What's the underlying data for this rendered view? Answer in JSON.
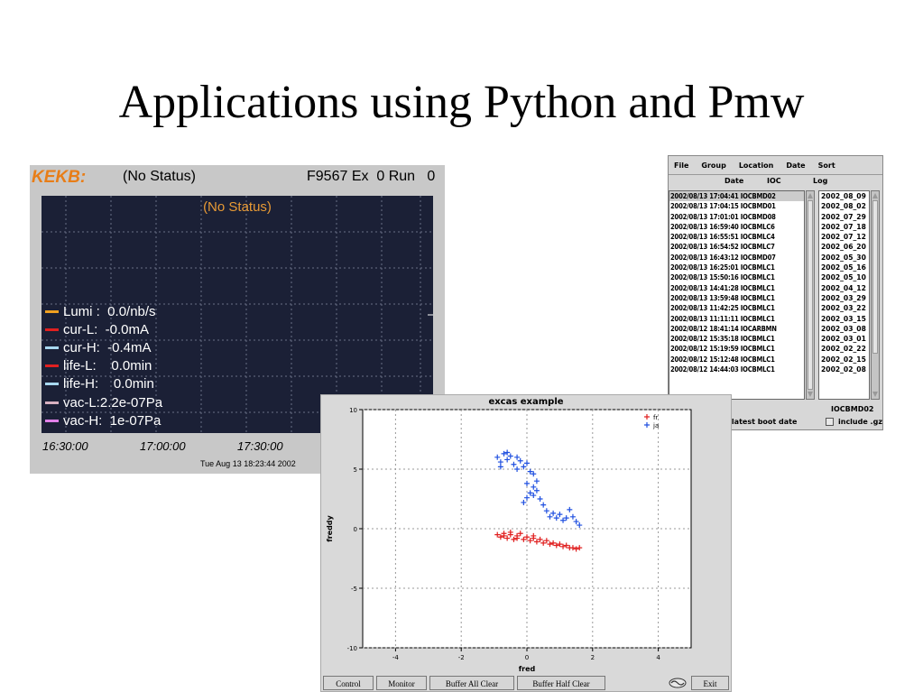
{
  "slide": {
    "title": "Applications using Python and Pmw"
  },
  "kekb": {
    "logo": "KEKB:",
    "status": "(No Status)",
    "info": "F9567 Ex  0 Run   0",
    "plot_status": "(No Status)",
    "legend": [
      {
        "label": "Lumi :  0.0/nb/s",
        "color": "#f0a020"
      },
      {
        "label": "cur-L:  -0.0mA",
        "color": "#e02020"
      },
      {
        "label": "cur-H:  -0.4mA",
        "color": "#a8d8f0"
      },
      {
        "label": "life-L:    0.0min",
        "color": "#e02020"
      },
      {
        "label": "life-H:    0.0min",
        "color": "#a8d8f0"
      },
      {
        "label": "vac-L:2.2e-07Pa",
        "color": "#d8b0c0"
      },
      {
        "label": "vac-H:  1e-07Pa",
        "color": "#e080e8"
      }
    ],
    "time_ticks": [
      "16:30:00",
      "17:00:00",
      "17:30:00"
    ],
    "timestamp": "Tue Aug 13 18:23:44 2002"
  },
  "logview": {
    "menu": [
      "File",
      "Group",
      "Location",
      "Date",
      "Sort"
    ],
    "columns": {
      "date": "Date",
      "ioc": "IOC",
      "log": "Log"
    },
    "rows": [
      "2002/08/13 17:04:41 IOCBMD02",
      "2002/08/13 17:04:15 IOCBMD01",
      "2002/08/13 17:01:01 IOCBMD08",
      "2002/08/13 16:59:40 IOCBMLC6",
      "2002/08/13 16:55:51 IOCBMLC4",
      "2002/08/13 16:54:52 IOCBMLC7",
      "2002/08/13 16:43:12 IOCBMD07",
      "2002/08/13 16:25:01 IOCBMLC1",
      "2002/08/13 15:50:16 IOCBMLC1",
      "2002/08/13 14:41:28 IOCBMLC1",
      "2002/08/13 13:59:48 IOCBMLC1",
      "2002/08/13 11:42:25 IOCBMLC1",
      "2002/08/13 11:11:11 IOCBMLC1",
      "2002/08/12 18:41:14 IOCARBMN",
      "2002/08/12 15:35:18 IOCBMLC1",
      "2002/08/12 15:19:59 IOCBMLC1",
      "2002/08/12 15:12:48 IOCBMLC1",
      "2002/08/12 14:44:03 IOCBMLC1"
    ],
    "dates": [
      "2002_08_09",
      "2002_08_02",
      "2002_07_29",
      "2002_07_18",
      "2002_07_12",
      "2002_06_20",
      "2002_05_30",
      "2002_05_16",
      "2002_05_10",
      "2002_04_12",
      "2002_03_29",
      "2002_03_22",
      "2002_03_15",
      "2002_03_08",
      "2002_03_01",
      "2002_02_22",
      "2002_02_15",
      "2002_02_08"
    ],
    "ioc_selected": "IOCBMD02",
    "check_latest": "only latest boot date",
    "check_gz": "include .gz"
  },
  "excas": {
    "title": "excas example",
    "xlabel": "fred",
    "ylabel": "freddy",
    "legend_labels": [
      "fr",
      "ja"
    ],
    "buttons": [
      "Control",
      "Monitor",
      "Buffer All Clear",
      "Buffer Half Clear",
      "Exit"
    ]
  },
  "chart_data": {
    "type": "scatter",
    "title": "excas example",
    "xlabel": "fred",
    "ylabel": "freddy",
    "xlim": [
      -5,
      5
    ],
    "ylim": [
      -10,
      10
    ],
    "xticks": [
      -4,
      -2,
      0,
      2,
      4
    ],
    "yticks": [
      10,
      5,
      0,
      -5,
      -10
    ],
    "grid": true,
    "legend_position": "top-right",
    "series": [
      {
        "name": "fr",
        "color": "#e02020",
        "points": [
          [
            -0.9,
            -0.5
          ],
          [
            -0.8,
            -0.7
          ],
          [
            -0.7,
            -0.4
          ],
          [
            -0.6,
            -0.8
          ],
          [
            -0.5,
            -0.5
          ],
          [
            -0.4,
            -0.9
          ],
          [
            -0.3,
            -0.6
          ],
          [
            -0.2,
            -0.4
          ],
          [
            -0.1,
            -0.9
          ],
          [
            0.0,
            -0.7
          ],
          [
            0.1,
            -1.0
          ],
          [
            0.2,
            -0.8
          ],
          [
            0.3,
            -1.1
          ],
          [
            0.4,
            -0.9
          ],
          [
            0.5,
            -1.2
          ],
          [
            0.6,
            -1.0
          ],
          [
            0.7,
            -1.3
          ],
          [
            0.8,
            -1.2
          ],
          [
            0.9,
            -1.4
          ],
          [
            1.0,
            -1.3
          ],
          [
            1.1,
            -1.5
          ],
          [
            1.2,
            -1.4
          ],
          [
            1.3,
            -1.6
          ],
          [
            1.4,
            -1.6
          ],
          [
            1.5,
            -1.7
          ],
          [
            1.6,
            -1.6
          ],
          [
            -0.7,
            -0.6
          ],
          [
            -0.5,
            -0.3
          ],
          [
            -0.3,
            -0.8
          ],
          [
            0.2,
            -0.6
          ]
        ]
      },
      {
        "name": "ja",
        "color": "#2050e0",
        "points": [
          [
            -0.9,
            6.0
          ],
          [
            -0.8,
            5.6
          ],
          [
            -0.7,
            6.3
          ],
          [
            -0.6,
            5.8
          ],
          [
            -0.5,
            6.1
          ],
          [
            -0.4,
            5.4
          ],
          [
            -0.3,
            6.0
          ],
          [
            -0.2,
            5.7
          ],
          [
            -0.1,
            5.2
          ],
          [
            0.0,
            5.5
          ],
          [
            0.1,
            4.8
          ],
          [
            0.2,
            4.6
          ],
          [
            0.3,
            4.0
          ],
          [
            0.2,
            3.5
          ],
          [
            0.1,
            3.0
          ],
          [
            0.0,
            2.6
          ],
          [
            -0.1,
            2.2
          ],
          [
            0.2,
            2.8
          ],
          [
            0.4,
            2.5
          ],
          [
            0.5,
            2.0
          ],
          [
            0.6,
            1.5
          ],
          [
            0.7,
            1.0
          ],
          [
            0.9,
            0.9
          ],
          [
            1.0,
            1.2
          ],
          [
            1.1,
            0.7
          ],
          [
            1.2,
            0.9
          ],
          [
            1.3,
            1.6
          ],
          [
            1.4,
            1.0
          ],
          [
            1.5,
            0.6
          ],
          [
            1.6,
            0.3
          ],
          [
            -0.8,
            5.2
          ],
          [
            -0.6,
            6.4
          ],
          [
            -0.3,
            5.0
          ],
          [
            0.0,
            3.8
          ],
          [
            0.3,
            3.2
          ],
          [
            0.8,
            1.3
          ]
        ]
      }
    ]
  }
}
